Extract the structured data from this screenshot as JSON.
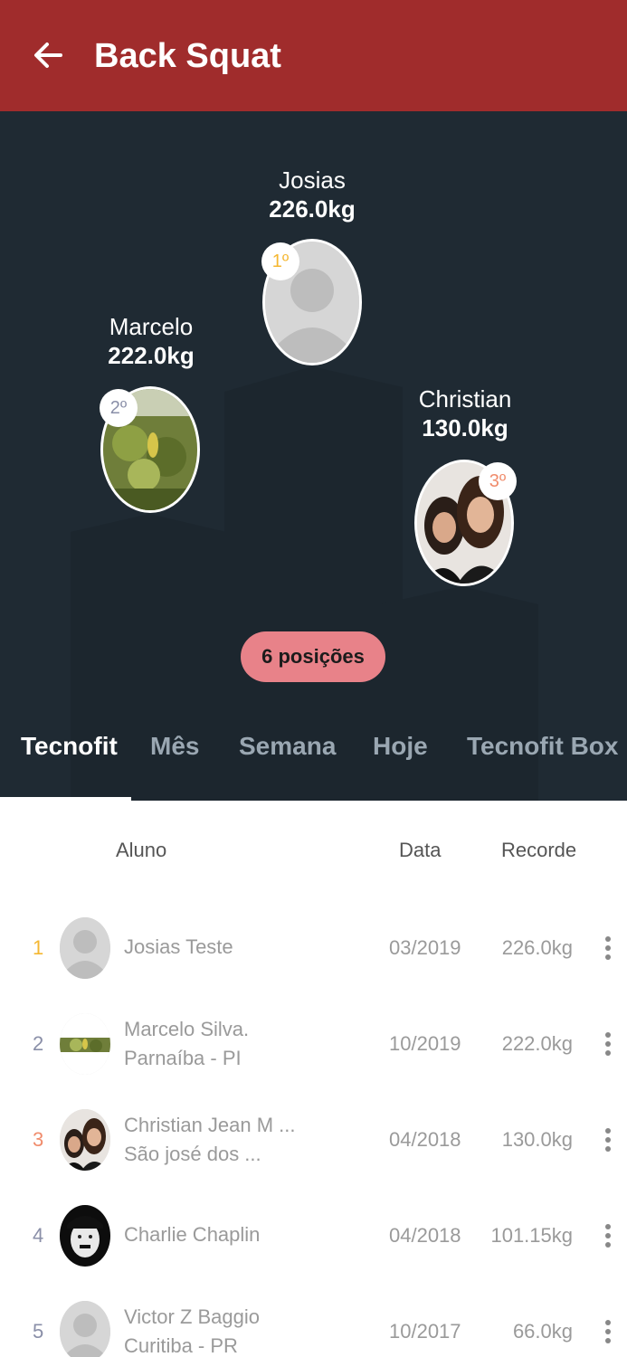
{
  "appbar": {
    "title": "Back Squat",
    "back_icon": "arrow-left-icon"
  },
  "podium": {
    "first": {
      "name": "Josias",
      "value": "226.0kg",
      "rank": "1º",
      "rank_color": "#f5b731"
    },
    "second": {
      "name": "Marcelo",
      "value": "222.0kg",
      "rank": "2º",
      "rank_color": "#8a8fa8"
    },
    "third": {
      "name": "Christian",
      "value": "130.0kg",
      "rank": "3º",
      "rank_color": "#f08c6c"
    },
    "positions_label": "6 posições"
  },
  "tabs": [
    {
      "label": "Tecnofit",
      "active": true
    },
    {
      "label": "Mês",
      "active": false
    },
    {
      "label": "Semana",
      "active": false
    },
    {
      "label": "Hoje",
      "active": false
    },
    {
      "label": "Tecnofit Box",
      "active": false
    }
  ],
  "table": {
    "headers": {
      "student": "Aluno",
      "date": "Data",
      "record": "Recorde"
    },
    "rows": [
      {
        "rank": "1",
        "rank_color": "#f5b731",
        "name": "Josias Teste",
        "location": "",
        "date": "03/2019",
        "record": "226.0kg",
        "avatar": "default"
      },
      {
        "rank": "2",
        "rank_color": "#8a8fa8",
        "name": "Marcelo Silva.",
        "location": "Parnaíba - PI",
        "date": "10/2019",
        "record": "222.0kg",
        "avatar": "plant"
      },
      {
        "rank": "3",
        "rank_color": "#f08c6c",
        "name": "Christian Jean M ...",
        "location": "São josé dos ...",
        "date": "04/2018",
        "record": "130.0kg",
        "avatar": "two-women"
      },
      {
        "rank": "4",
        "rank_color": "#8a8fa8",
        "name": "Charlie Chaplin",
        "location": "",
        "date": "04/2018",
        "record": "101.15kg",
        "avatar": "chaplin"
      },
      {
        "rank": "5",
        "rank_color": "#8a8fa8",
        "name": "Victor Z Baggio",
        "location": "Curitiba - PR",
        "date": "10/2017",
        "record": "66.0kg",
        "avatar": "default"
      }
    ]
  },
  "colors": {
    "appbar": "#a02c2c",
    "podium_bg": "#1f2a33",
    "pill": "#e88289"
  }
}
